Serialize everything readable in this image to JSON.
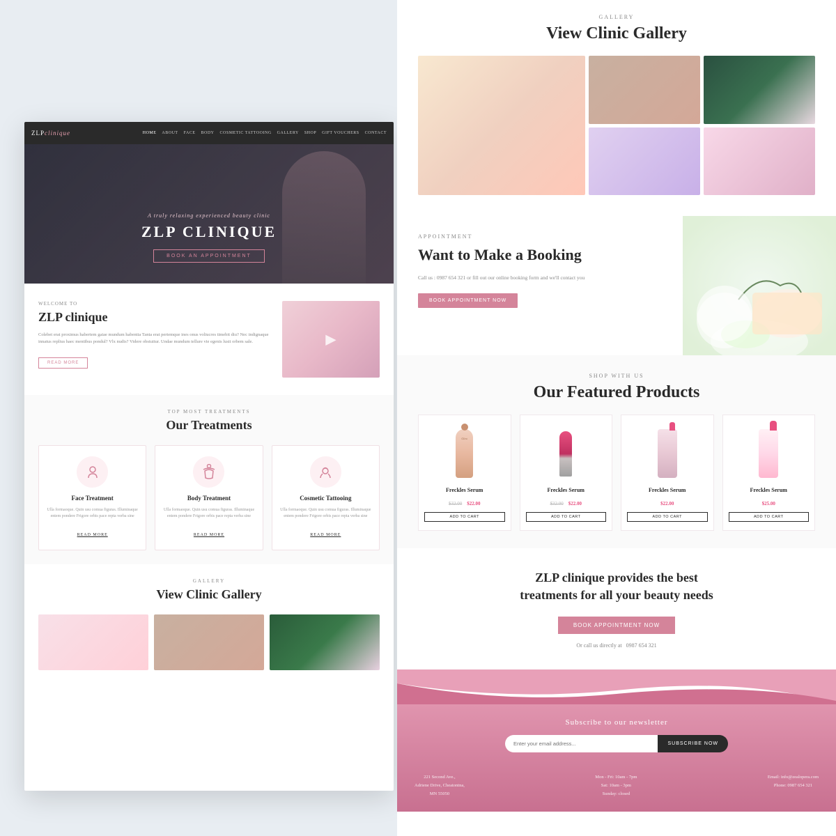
{
  "site": {
    "name": "ZLP",
    "name_italic": "clinique",
    "tagline": "A truly relaxing experienced beauty clinic",
    "title": "ZLP CLINIQUE"
  },
  "nav": {
    "links": [
      "HOME",
      "ABOUT",
      "FACE",
      "BODY",
      "COSMETIC TATTOOING",
      "GALLERY",
      "SHOP",
      "GIFT VOUCHERS",
      "CONTACT"
    ],
    "active": "HOME"
  },
  "hero": {
    "book_btn": "BOOK AN APPOINTMENT"
  },
  "welcome": {
    "label": "WELCOME TO",
    "title": "ZLP clinique",
    "body": "Colebet erat proximus habertem gaiae mundum habentia Tanta erat pertemque ines onus voliucres timebit diu? Nec indignaque innatus replius haec mentibus pondul? Vlx nudis? Videre obstuitur. Undae mundum tellure vie egenis lusit orbem sale.",
    "read_more": "READ MORE"
  },
  "treatments": {
    "label": "TOP MOST TREATMENTS",
    "title": "Our Treatments",
    "items": [
      {
        "name": "Face Treatment",
        "icon": "👤",
        "desc": "Ulla formaoque. Quin usu comua figuras. Illuminaque entem pondere Friore orbis pace repta verba sine",
        "link": "READ MORE"
      },
      {
        "name": "Body Treatment",
        "icon": "🧖",
        "desc": "Ulla formaoque. Quin usu comua figuras. Illuminaque entem pondere Friore orbis pace repta verba sine",
        "link": "READ MORE"
      },
      {
        "name": "Cosmetic Tattooing",
        "icon": "💆",
        "desc": "Ulla formaoque. Quin usu comua figuras. Illuminaque entem pondere Friore orbis pace repta verba sine",
        "link": "READ MORE"
      }
    ]
  },
  "gallery": {
    "label": "GALLERY",
    "title": "View Clinic Gallery"
  },
  "appointment": {
    "label": "APPOINTMENT",
    "title": "Want to Make a Booking",
    "desc": "Call us : 0987 654 321 or fill out our online booking form and we'll contact you",
    "btn": "BOOK APPOINTMENT NOW"
  },
  "products": {
    "label": "SHOP WITH US",
    "title": "Our Featured Products",
    "items": [
      {
        "name": "Freckles Serum",
        "price_old": "$32.00",
        "price_new": "$22.00",
        "add_cart": "ADD TO CART"
      },
      {
        "name": "Freckles Serum",
        "price_old": "$32.00",
        "price_new": "$22.00",
        "add_cart": "ADD TO CART"
      },
      {
        "name": "Freckles Serum",
        "price_new": "$22.00",
        "add_cart": "ADD TO CART"
      },
      {
        "name": "Freckles Serum",
        "price_new": "$25.00",
        "add_cart": "ADD TO CART"
      }
    ]
  },
  "cta": {
    "title": "ZLP clinique provides the best\ntreatments for all your beauty needs",
    "btn": "BOOK APPOINTMENT NOW",
    "phone_text": "Or call us directly at",
    "phone": "0987 654 321"
  },
  "newsletter": {
    "title": "Subscribe to our newsletter",
    "placeholder": "Enter your email address...",
    "btn": "SUBSCRIBE NOW"
  },
  "footer": {
    "address": {
      "line1": "221 Second Ave.,",
      "line2": "Adriene Drive, Cheatontna,",
      "line3": "MN 55050"
    },
    "hours": {
      "line1": "Mon - Fri: 10am - 7pm",
      "line2": "Sat: 10am - 3pm",
      "line3": "Sunday: closed"
    },
    "contact": {
      "line1": "Email: info@zealopera.com",
      "line2": "Phone: 0987 654 321"
    }
  }
}
